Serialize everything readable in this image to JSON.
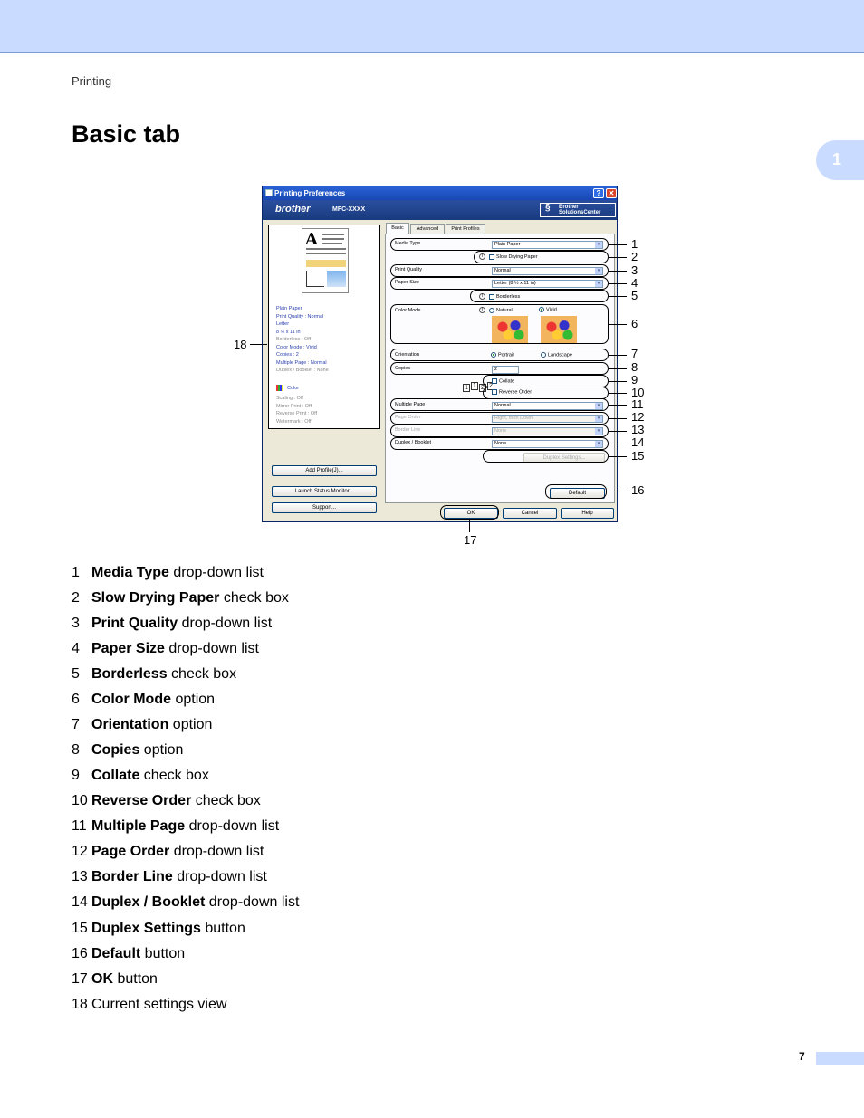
{
  "header": {
    "running_head": "Printing",
    "chapter_tab": "1"
  },
  "title": "Basic tab",
  "dialog": {
    "title": "Printing Preferences",
    "help_glyph": "?",
    "close_glyph": "✕",
    "brand": "brother",
    "model": "MFC-XXXX",
    "solutions_center": [
      "Brother",
      "SolutionsCenter"
    ],
    "tabs": [
      "Basic",
      "Advanced",
      "Print Profiles"
    ],
    "settings_view": {
      "lines": [
        "Plain Paper",
        "Print Quality : Normal",
        "Letter",
        "8 ½ x 11 in"
      ],
      "grey_lines": [
        "Borderless : Off",
        "Color Mode : Vivid",
        "Copies : 2",
        "Multiple Page : Normal",
        "Duplex / Booklet : None"
      ],
      "color_label": "Color",
      "lines2": [
        "Scaling : Off",
        "Mirror Print : Off",
        "Reverse Print : Off",
        "Watermark : Off"
      ]
    },
    "left_buttons": [
      "Add Profile(J)...",
      "Launch Status Monitor...",
      "Support..."
    ],
    "fields": {
      "media_type": {
        "label": "Media Type",
        "value": "Plain Paper"
      },
      "slow_drying": "Slow Drying Paper",
      "print_quality": {
        "label": "Print Quality",
        "value": "Normal"
      },
      "paper_size": {
        "label": "Paper Size",
        "value": "Letter (8 ½ x 11 in)"
      },
      "borderless": "Borderless",
      "color_mode": {
        "label": "Color Mode",
        "natural": "Natural",
        "vivid": "Vivid"
      },
      "orientation": {
        "label": "Orientation",
        "portrait": "Portrait",
        "landscape": "Landscape"
      },
      "copies": {
        "label": "Copies",
        "value": "2"
      },
      "collate": "Collate",
      "reverse_order": "Reverse Order",
      "multiple_page": {
        "label": "Multiple Page",
        "value": "Normal"
      },
      "page_order": {
        "label": "Page Order",
        "value": "Right, then Down"
      },
      "border_line": {
        "label": "Border Line",
        "value": "None"
      },
      "duplex": {
        "label": "Duplex / Booklet",
        "value": "None"
      },
      "duplex_settings": "Duplex Settings...",
      "default": "Default"
    },
    "bottom_buttons": {
      "ok": "OK",
      "cancel": "Cancel",
      "help": "Help"
    },
    "info_glyph": "i",
    "dropdown_glyph": "▾",
    "collate_icons": [
      "1",
      "1",
      "2",
      "2"
    ]
  },
  "callouts": [
    "1",
    "2",
    "3",
    "4",
    "5",
    "6",
    "7",
    "8",
    "9",
    "10",
    "11",
    "12",
    "13",
    "14",
    "15",
    "16",
    "17",
    "18"
  ],
  "legend": [
    {
      "num": "1",
      "bold": "Media Type",
      "rest": " drop-down list"
    },
    {
      "num": "2",
      "bold": "Slow Drying Paper",
      "rest": " check box"
    },
    {
      "num": "3",
      "bold": "Print Quality",
      "rest": " drop-down list"
    },
    {
      "num": "4",
      "bold": "Paper Size",
      "rest": " drop-down list"
    },
    {
      "num": "5",
      "bold": "Borderless",
      "rest": " check box"
    },
    {
      "num": "6",
      "bold": "Color Mode",
      "rest": " option"
    },
    {
      "num": "7",
      "bold": "Orientation",
      "rest": " option"
    },
    {
      "num": "8",
      "bold": "Copies",
      "rest": " option"
    },
    {
      "num": "9",
      "bold": "Collate",
      "rest": " check box"
    },
    {
      "num": "10",
      "bold": "Reverse Order",
      "rest": " check box"
    },
    {
      "num": "11",
      "bold": "Multiple Page",
      "rest": " drop-down list"
    },
    {
      "num": "12",
      "bold": "Page Order",
      "rest": " drop-down list"
    },
    {
      "num": "13",
      "bold": "Border Line",
      "rest": " drop-down list"
    },
    {
      "num": "14",
      "bold": "Duplex / Booklet",
      "rest": " drop-down list"
    },
    {
      "num": "15",
      "bold": "Duplex Settings",
      "rest": " button"
    },
    {
      "num": "16",
      "bold": "Default",
      "rest": " button"
    },
    {
      "num": "17",
      "bold": "OK",
      "rest": " button"
    },
    {
      "num": "18",
      "bold": "",
      "rest": "Current settings view"
    }
  ],
  "page_number": "7"
}
